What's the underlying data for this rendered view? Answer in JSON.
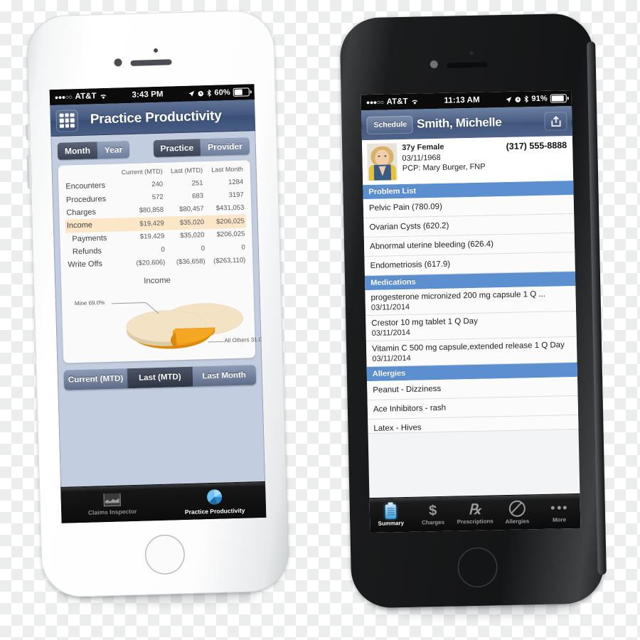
{
  "left_phone": {
    "statusbar": {
      "carrier": "AT&T",
      "time": "3:43 PM",
      "battery": "60%",
      "signal_dots": "●●●○○"
    },
    "nav": {
      "title": "Practice Productivity",
      "menu_icon": "grid-icon"
    },
    "segments": {
      "period": [
        {
          "label": "Month",
          "selected": true
        },
        {
          "label": "Year",
          "selected": false
        }
      ],
      "scope": [
        {
          "label": "Practice",
          "selected": true
        },
        {
          "label": "Provider",
          "selected": false
        }
      ]
    },
    "table": {
      "columns": [
        "",
        "Current (MTD)",
        "Last (MTD)",
        "Last Month"
      ],
      "rows": [
        {
          "label": "Encounters",
          "indent": false,
          "highlight": false,
          "values": [
            "240",
            "251",
            "1284"
          ]
        },
        {
          "label": "Procedures",
          "indent": false,
          "highlight": false,
          "values": [
            "572",
            "683",
            "3197"
          ]
        },
        {
          "label": "Charges",
          "indent": false,
          "highlight": false,
          "values": [
            "$80,858",
            "$80,457",
            "$431,053"
          ]
        },
        {
          "label": "Income",
          "indent": false,
          "highlight": true,
          "values": [
            "$19,429",
            "$35,020",
            "$206,025"
          ]
        },
        {
          "label": "Payments",
          "indent": true,
          "highlight": false,
          "values": [
            "$19,429",
            "$35,020",
            "$206,025"
          ]
        },
        {
          "label": "Refunds",
          "indent": true,
          "highlight": false,
          "values": [
            "0",
            "0",
            "0"
          ]
        },
        {
          "label": "Write Offs",
          "indent": false,
          "highlight": false,
          "values": [
            "($20,606)",
            "($36,658)",
            "($263,110)"
          ]
        }
      ]
    },
    "chart_data": {
      "type": "pie",
      "title": "Income",
      "labels": [
        "Mine 69.0%",
        "All Others 31.0"
      ],
      "categories": [
        "Mine",
        "All Others"
      ],
      "values": [
        69.0,
        31.0
      ],
      "colors": [
        "#f3e3c4",
        "#f5a623"
      ],
      "legend": "callout-labels",
      "three_d": true
    },
    "range_buttons": [
      {
        "label": "Current (MTD)",
        "selected": false
      },
      {
        "label": "Last (MTD)",
        "selected": true
      },
      {
        "label": "Last Month",
        "selected": false
      }
    ],
    "tabbar": [
      {
        "label": "Claims Inspector",
        "icon": "chart-icon",
        "active": false
      },
      {
        "label": "Practice Productivity",
        "icon": "pie-chart-icon",
        "active": true
      }
    ]
  },
  "right_phone": {
    "statusbar": {
      "carrier": "AT&T",
      "time": "11:13 AM",
      "battery": "91%",
      "signal_dots": "●●●○○"
    },
    "nav": {
      "back_label": "Schedule",
      "title": "Smith, Michelle",
      "share_icon": "share-icon"
    },
    "patient": {
      "age_sex": "37y Female",
      "dob": "03/11/1968",
      "pcp": "PCP: Mary Burger, FNP",
      "phone": "(317) 555-8888",
      "avatar": "patient-photo"
    },
    "sections": [
      {
        "title": "Problem List",
        "items": [
          {
            "primary": "Pelvic Pain (780.09)"
          },
          {
            "primary": "Ovarian Cysts (620.2)"
          },
          {
            "primary": "Abnormal uterine bleeding (626.4)"
          },
          {
            "primary": "Endometriosis (617.9)"
          }
        ]
      },
      {
        "title": "Medications",
        "items": [
          {
            "primary": "progesterone micronized 200 mg capsule 1 Q ...",
            "secondary": "03/11/2014"
          },
          {
            "primary": "Crestor 10 mg tablet 1 Q Day",
            "secondary": "03/11/2014"
          },
          {
            "primary": "Vitamin C 500 mg capsule,extended release 1 Q Day",
            "secondary": "03/11/2014"
          }
        ]
      },
      {
        "title": "Allergies",
        "items": [
          {
            "primary": "Peanut - Dizziness"
          },
          {
            "primary": "Ace Inhibitors - rash"
          },
          {
            "primary": "Latex - Hives"
          }
        ]
      }
    ],
    "tabbar": [
      {
        "label": "Summary",
        "icon": "clipboard-icon",
        "active": true
      },
      {
        "label": "Charges",
        "icon": "dollar-icon",
        "active": false
      },
      {
        "label": "Prescriptions",
        "icon": "rx-icon",
        "active": false
      },
      {
        "label": "Allergies",
        "icon": "ban-icon",
        "active": false
      },
      {
        "label": "More",
        "icon": "ellipsis-icon",
        "active": false
      }
    ]
  },
  "colors": {
    "nav_blue": "#4a5f86",
    "section_blue": "#5b8fd0",
    "highlight": "#fbe6c8",
    "pie_orange": "#f5a623",
    "pie_cream": "#f3e3c4"
  }
}
